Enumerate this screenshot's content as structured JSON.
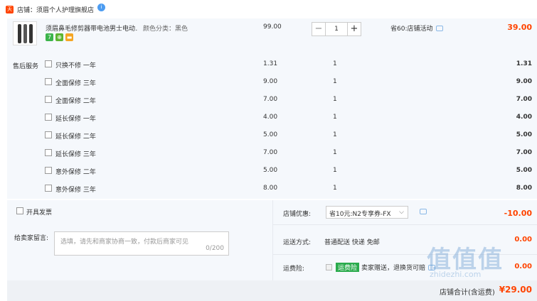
{
  "shop": {
    "badge": "天猫",
    "label": "店铺：",
    "name": "须眉个人护理旗舰店",
    "info_icon": "i"
  },
  "item": {
    "name": "须眉鼻毛修剪器带电池男士电动...",
    "spec": "颜色分类：黑色",
    "price": "99.00",
    "quantity": "1",
    "minus": "−",
    "plus": "+",
    "promo": "省60:店铺活动",
    "total": "39.00",
    "tags": [
      {
        "text": "7",
        "color": "#3cb44b"
      },
      {
        "text": "⊕",
        "color": "#5cb531"
      },
      {
        "text": "▬",
        "color": "#f5a623"
      }
    ]
  },
  "services": {
    "label": "售后服务",
    "items": [
      {
        "name": "只换不修 一年",
        "price": "1.31",
        "qty": "1",
        "total": "1.31"
      },
      {
        "name": "全面保修 三年",
        "price": "9.00",
        "qty": "1",
        "total": "9.00"
      },
      {
        "name": "全面保修 二年",
        "price": "7.00",
        "qty": "1",
        "total": "7.00"
      },
      {
        "name": "延长保修 一年",
        "price": "4.00",
        "qty": "1",
        "total": "4.00"
      },
      {
        "name": "延长保修 二年",
        "price": "5.00",
        "qty": "1",
        "total": "5.00"
      },
      {
        "name": "延长保修 三年",
        "price": "7.00",
        "qty": "1",
        "total": "7.00"
      },
      {
        "name": "意外保修 二年",
        "price": "5.00",
        "qty": "1",
        "total": "5.00"
      },
      {
        "name": "意外保修 三年",
        "price": "8.00",
        "qty": "1",
        "total": "8.00"
      }
    ]
  },
  "order": {
    "invoice_label": "开具发票",
    "message_label": "给卖家留言:",
    "message_placeholder": "选填，请先和商家协商一致，付款后商家可见",
    "message_count": "0/200",
    "coupon_label": "店铺优惠:",
    "coupon_value": "省10元:N2专享券-FX",
    "coupon_arrow": "⌵",
    "coupon_amount": "-10.00",
    "shipping_label": "运送方式:",
    "shipping_value": "普通配送 快递 免邮",
    "shipping_amount": "0.00",
    "insurance_label": "运费险:",
    "insurance_badge": "运费险",
    "insurance_value": "卖家赠送，退换货可赔",
    "insurance_amount": "0.00",
    "pay_label": "店铺合计(含运费)",
    "pay_amount": "¥29.00"
  },
  "watermark": {
    "text": "值值值",
    "sub": "zhidezhi.com"
  },
  "colors": {
    "accent": "#ff4400",
    "panel": "#f5f8fc",
    "insurance": "#2bab4d"
  }
}
